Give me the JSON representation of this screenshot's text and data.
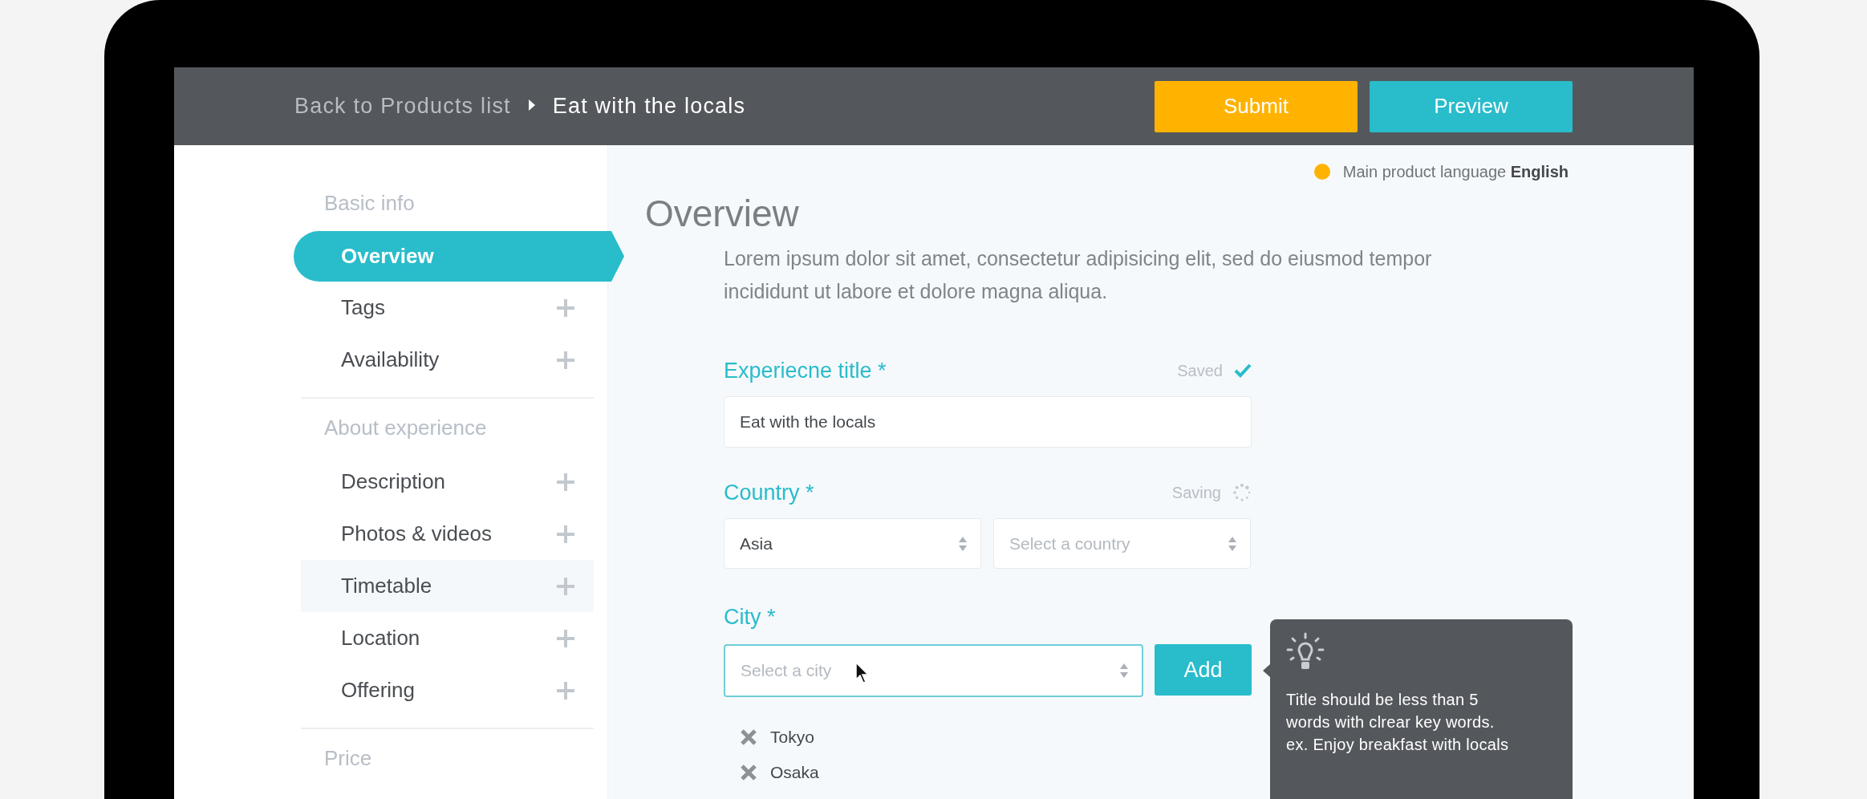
{
  "header": {
    "breadcrumb_parent": "Back to Products list",
    "breadcrumb_current": "Eat with the locals",
    "buttons": [
      {
        "label": "Submit",
        "kind": "secondary"
      },
      {
        "label": "Preview",
        "kind": "primary"
      }
    ]
  },
  "sidebar": {
    "sections": [
      {
        "title": "Basic info",
        "items": [
          {
            "label": "Overview",
            "selected": true,
            "highlighted": false
          },
          {
            "label": "Tags",
            "selected": false,
            "highlighted": false
          },
          {
            "label": "Availability",
            "selected": false,
            "highlighted": false
          }
        ]
      },
      {
        "title": "About experience",
        "items": [
          {
            "label": "Description",
            "selected": false,
            "highlighted": false
          },
          {
            "label": "Photos & videos",
            "selected": false,
            "highlighted": false
          },
          {
            "label": "Timetable",
            "selected": false,
            "highlighted": true
          },
          {
            "label": "Location",
            "selected": false,
            "highlighted": false
          },
          {
            "label": "Offering",
            "selected": false,
            "highlighted": false
          }
        ]
      },
      {
        "title": "Price"
      }
    ]
  },
  "language": {
    "text": "Main product language **English**"
  },
  "content": {
    "title": "Overview",
    "description": "Lorem ipsum dolor sit amet, consectetur adipisicing elit, sed do eiusmod tempor incididunt ut labore et dolore magna aliqua.",
    "fields": [
      {
        "kind": "text",
        "label": "Experiecne title *",
        "status": {
          "kind": "saved",
          "text": "Saved"
        },
        "value": "Eat with the locals"
      },
      {
        "kind": "selects",
        "label": "Country *",
        "status": {
          "kind": "saving",
          "text": "Saving"
        },
        "selects": [
          {
            "value": "Asia"
          },
          {
            "placeholder": "Select a country"
          }
        ]
      },
      {
        "kind": "city",
        "label": "City *",
        "placeholder": "Select a city",
        "focused": true,
        "button": "Add",
        "tags": [
          "Tokyo",
          "Osaka"
        ]
      }
    ]
  },
  "tooltip": {
    "lines": [
      "Title should be less than 5",
      "words with clrear key words.",
      "ex. Enjoy breakfast with locals"
    ]
  }
}
